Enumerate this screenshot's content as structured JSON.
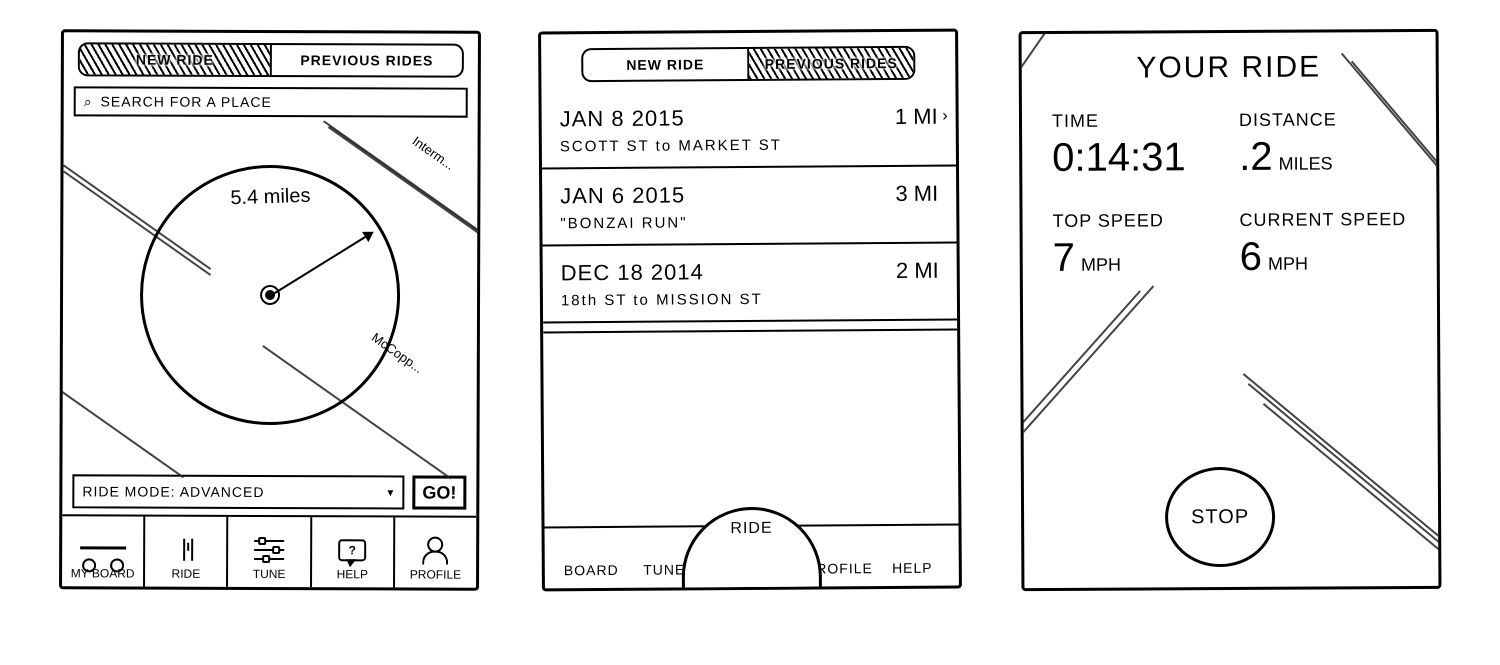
{
  "screen1": {
    "tabs": {
      "new": "NEW RIDE",
      "previous": "PREVIOUS RIDES"
    },
    "search_placeholder": "SEARCH FOR A PLACE",
    "map": {
      "radius_label": "5.4 miles",
      "road1": "Interm...",
      "road2": "McCopp..."
    },
    "mode": {
      "prefix": "RIDE MODE:",
      "value": "ADVANCED"
    },
    "go_label": "GO!",
    "nav": {
      "board": "MY BOARD",
      "ride": "RIDE",
      "tune": "TUNE",
      "help": "HELP",
      "profile": "PROFILE"
    }
  },
  "screen2": {
    "tabs": {
      "new": "NEW RIDE",
      "previous": "PREVIOUS RIDES"
    },
    "rides": [
      {
        "date": "JAN 8 2015",
        "distance": "1 MI",
        "subtitle": "SCOTT ST to MARKET ST",
        "chevron": true
      },
      {
        "date": "JAN 6 2015",
        "distance": "3 MI",
        "subtitle": "\"BONZAI RUN\"",
        "chevron": false
      },
      {
        "date": "DEC 18 2014",
        "distance": "2 MI",
        "subtitle": "18th ST to MISSION ST",
        "chevron": false
      }
    ],
    "nav": {
      "board": "BOARD",
      "tune": "TUNE",
      "ride": "RIDE",
      "profile": "PROFILE",
      "help": "HELP"
    }
  },
  "screen3": {
    "title": "YOUR RIDE",
    "time": {
      "label": "TIME",
      "value": "0:14:31"
    },
    "distance": {
      "label": "DISTANCE",
      "value": ".2",
      "unit": "MILES"
    },
    "top_speed": {
      "label": "TOP SPEED",
      "value": "7",
      "unit": "MPH"
    },
    "current_speed": {
      "label": "CURRENT SPEED",
      "value": "6",
      "unit": "MPH"
    },
    "stop_label": "STOP"
  }
}
